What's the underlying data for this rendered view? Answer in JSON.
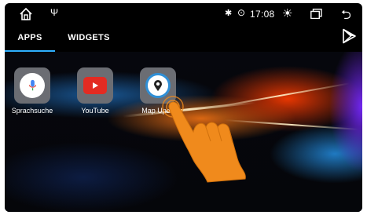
{
  "status_bar": {
    "home_icon": "home-icon",
    "usb_icon": "usb-icon",
    "bluetooth_icon": "bluetooth-icon",
    "location_icon": "location-icon",
    "time": "17:08",
    "brightness_icon": "brightness-icon",
    "recent_apps_icon": "recent-apps-icon",
    "back_icon": "back-icon"
  },
  "tabs": [
    {
      "label": "APPS",
      "active": true
    },
    {
      "label": "WIDGETS",
      "active": false
    }
  ],
  "store_icon": "play-store-icon",
  "apps": [
    {
      "label": "Sprachsuche",
      "icon": "microphone-icon"
    },
    {
      "label": "YouTube",
      "icon": "youtube-icon"
    },
    {
      "label": "Map Upda",
      "icon": "map-update-icon"
    }
  ],
  "colors": {
    "tab_underline": "#2fb0ff",
    "hand": "#f08a1c",
    "youtube_red": "#e32b22"
  }
}
